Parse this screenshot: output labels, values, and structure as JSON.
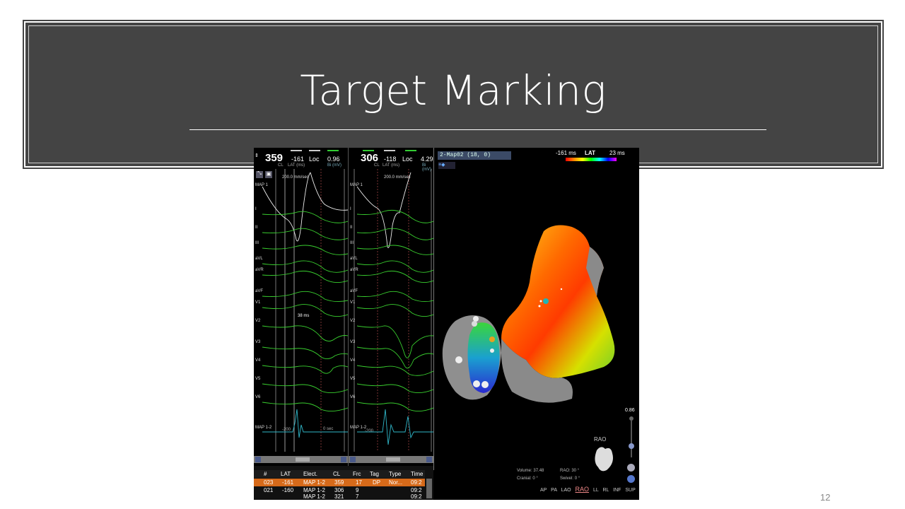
{
  "slide": {
    "title": "Target Marking",
    "page_number": "12"
  },
  "egm_left": {
    "cl": "359",
    "lat": "-161",
    "loc": "Loc",
    "bi": "0.96",
    "cl_label": "CL",
    "lat_label": "LAT (ms)",
    "bi_label": "Bi (mV)",
    "speed": "200.0 mm/sec",
    "measure": "38 ms",
    "scale_left": "-200",
    "scale_right": "0 sec"
  },
  "egm_right": {
    "cl": "306",
    "lat": "-118",
    "loc": "Loc",
    "bi": "4.29",
    "cl_label": "CL",
    "lat_label": "LAT (ms)",
    "bi_label": "Bi (mV)",
    "speed": "200.0 mm/sec",
    "scale_left": "-200"
  },
  "channels": [
    "MAP 1",
    "I",
    "II",
    "III",
    "aVL",
    "aVR",
    "aVF",
    "V1",
    "V2",
    "V3",
    "V4",
    "V5",
    "V6",
    "MAP 1-2"
  ],
  "map": {
    "name": "2-Map02 (18, 0)",
    "lat_min": "-161 ms",
    "lat_title": "LAT",
    "lat_max": "23 ms",
    "volume_label": "Volume:",
    "volume": "37.48",
    "cranial_label": "Cranial:",
    "cranial": "0 °",
    "rao_label": "RAO:",
    "rao": "30 °",
    "swivel_label": "Swivel:",
    "swivel": "0 °",
    "orientation": "RAO",
    "slider_value": "0.86",
    "views": [
      "AP",
      "PA",
      "LAO",
      "RAO",
      "LL",
      "RL",
      "INF",
      "SUP"
    ]
  },
  "table": {
    "headers": [
      "#",
      "LAT",
      "Elect.",
      "CL",
      "Frc",
      "Tag",
      "Type",
      "Time"
    ],
    "rows": [
      [
        "023",
        "-161",
        "MAP 1-2",
        "359",
        "17",
        "DP",
        "Nor...",
        "09:2"
      ],
      [
        "021",
        "-160",
        "MAP 1-2",
        "306",
        "9",
        "",
        "",
        "09:2"
      ],
      [
        "",
        "",
        "MAP 1-2",
        "321",
        "7",
        "",
        "",
        "09:2"
      ]
    ]
  },
  "colors": {
    "title_band": "#444444",
    "egm_green": "#39d02f",
    "egm_cyan": "#2fb7c9",
    "row_highlight": "#d66a1a"
  }
}
